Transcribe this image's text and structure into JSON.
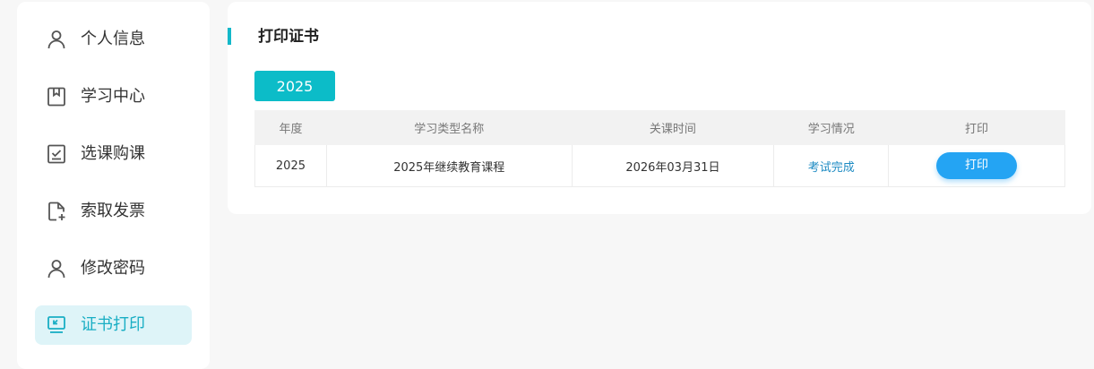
{
  "sidebar": {
    "items": [
      {
        "label": "个人信息",
        "icon": "user-icon",
        "active": false
      },
      {
        "label": "学习中心",
        "icon": "bookmark-icon",
        "active": false
      },
      {
        "label": "选课购课",
        "icon": "checkbox-icon",
        "active": false
      },
      {
        "label": "索取发票",
        "icon": "file-add-icon",
        "active": false
      },
      {
        "label": "修改密码",
        "icon": "user-icon",
        "active": false
      },
      {
        "label": "证书打印",
        "icon": "monitor-icon",
        "active": true
      }
    ]
  },
  "main": {
    "title": "打印证书",
    "year_tab": "2025",
    "table": {
      "headers": [
        "年度",
        "学习类型名称",
        "关课时间",
        "学习情况",
        "打印"
      ],
      "rows": [
        {
          "year": "2025",
          "type_name": "2025年继续教育课程",
          "close_time": "2026年03月31日",
          "status": "考试完成",
          "action": "打印"
        }
      ]
    }
  },
  "colors": {
    "accent": "#13b8c9",
    "active_bg": "#def4f8",
    "button": "#24a4f3",
    "link": "#1e8bc3"
  }
}
